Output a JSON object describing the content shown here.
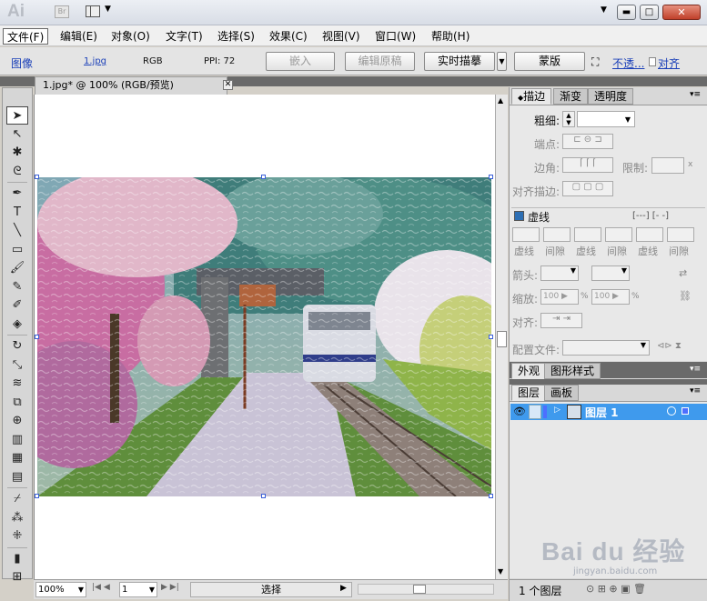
{
  "app": {
    "logo": "Ai",
    "bridge": "Br"
  },
  "window": {
    "min": "▬",
    "max": "□",
    "close": "✕"
  },
  "menu": [
    "文件(F)",
    "编辑(E)",
    "对象(O)",
    "文字(T)",
    "选择(S)",
    "效果(C)",
    "视图(V)",
    "窗口(W)",
    "帮助(H)"
  ],
  "control": {
    "type": "图像",
    "file": "1.jpg",
    "mode": "RGB",
    "ppi": "PPI: 72",
    "embed": "嵌入",
    "edit_original": "编辑原稿",
    "live_trace": "实时描摹",
    "mask": "蒙版",
    "opacity": "不透...",
    "align": "对齐"
  },
  "document": {
    "tab": "1.jpg* @ 100% (RGB/预览)",
    "zoom": "100%",
    "page": "1",
    "status": "选择"
  },
  "tools": [
    {
      "icon": "selection-arrow-icon",
      "g": "➤"
    },
    {
      "icon": "direct-selection-icon",
      "g": "↖"
    },
    {
      "icon": "magic-wand-icon",
      "g": "✱"
    },
    {
      "icon": "lasso-icon",
      "g": "ᘓ"
    },
    {
      "icon": "pen-icon",
      "g": "✒"
    },
    {
      "icon": "type-icon",
      "g": "T"
    },
    {
      "icon": "line-icon",
      "g": "╲"
    },
    {
      "icon": "rectangle-icon",
      "g": "▭"
    },
    {
      "icon": "paintbrush-icon",
      "g": "🖌"
    },
    {
      "icon": "pencil-icon",
      "g": "✎"
    },
    {
      "icon": "blob-brush-icon",
      "g": "✐"
    },
    {
      "icon": "eraser-icon",
      "g": "◈"
    },
    {
      "icon": "rotate-icon",
      "g": "↻"
    },
    {
      "icon": "scale-icon",
      "g": "⤡"
    },
    {
      "icon": "warp-icon",
      "g": "≋"
    },
    {
      "icon": "free-transform-icon",
      "g": "⧉"
    },
    {
      "icon": "shape-builder-icon",
      "g": "⊕"
    },
    {
      "icon": "graph-icon",
      "g": "▥"
    },
    {
      "icon": "mesh-icon",
      "g": "▦"
    },
    {
      "icon": "gradient-icon",
      "g": "▤"
    },
    {
      "icon": "eyedropper-icon",
      "g": "⌿"
    },
    {
      "icon": "blend-icon",
      "g": "⁂"
    },
    {
      "icon": "symbol-sprayer-icon",
      "g": "⁜"
    },
    {
      "icon": "column-graph-icon",
      "g": "▮"
    },
    {
      "icon": "artboard-icon",
      "g": "⊞"
    }
  ],
  "stroke_panel": {
    "tabs": [
      "描边",
      "渐变",
      "透明度"
    ],
    "weight_label": "粗细:",
    "cap_label": "端点:",
    "join_label": "边角:",
    "limit_label": "限制:",
    "limit_unit": "x",
    "align_label": "对齐描边:",
    "dashed_label": "虚线",
    "dash_labels": [
      "虚线",
      "间隙",
      "虚线",
      "间隙",
      "虚线",
      "间隙"
    ],
    "arrow_label": "箭头:",
    "scale_label": "缩放:",
    "scale1": "100",
    "scale2": "100",
    "pct": "%",
    "align2_label": "对齐:",
    "profile_label": "配置文件:"
  },
  "appearance_panel": {
    "tabs": [
      "外观",
      "图形样式"
    ]
  },
  "layers_panel": {
    "tabs": [
      "图层",
      "画板"
    ],
    "layer_name": "图层 1",
    "count": "1 个图层"
  },
  "watermark": {
    "text": "Bai du 经验",
    "sub": "jingyan.baidu.com"
  },
  "colors": {
    "selection": "#3f9aed",
    "handle": "#3a5fd8"
  }
}
